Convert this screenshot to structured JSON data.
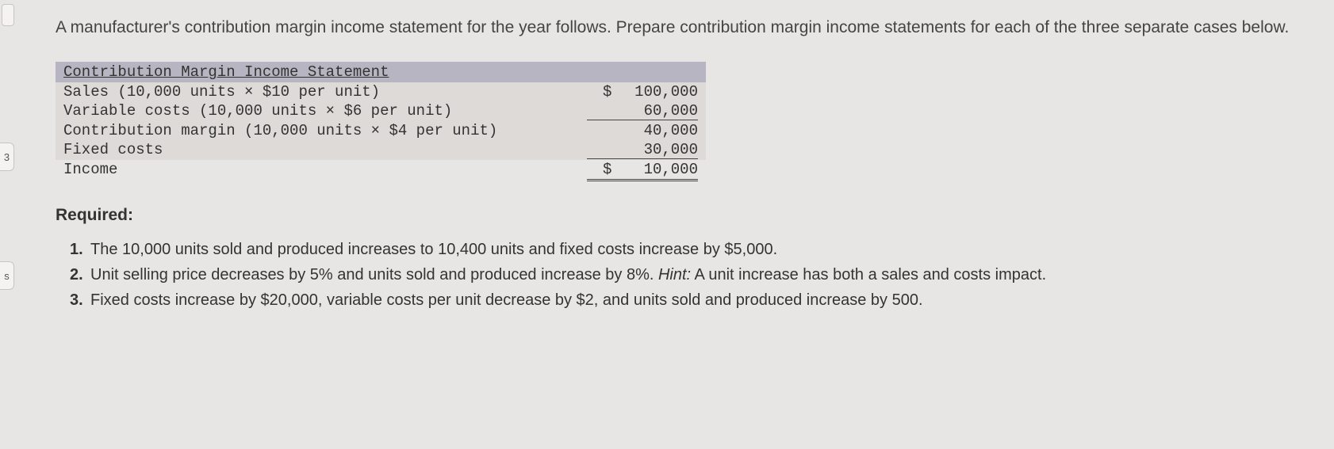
{
  "sidebar": {
    "tab1": "3",
    "tab2": "s"
  },
  "intro": "A manufacturer's contribution margin income statement for the year follows. Prepare contribution margin income statements for each of the three separate cases below.",
  "statement": {
    "header": "Contribution Margin Income Statement",
    "rows": [
      {
        "label": "Sales (10,000 units × $10 per unit)",
        "value": "100,000",
        "dollar": true
      },
      {
        "label": "Variable costs (10,000 units × $6 per unit)",
        "value": "60,000",
        "dollar": false
      },
      {
        "label": "Contribution margin (10,000 units × $4 per unit)",
        "value": "40,000",
        "dollar": false
      },
      {
        "label": "Fixed costs",
        "value": "30,000",
        "dollar": false
      },
      {
        "label": "Income",
        "value": "10,000",
        "dollar": true
      }
    ]
  },
  "required": {
    "header": "Required:",
    "items": [
      {
        "num": "1.",
        "text": "The 10,000 units sold and produced increases to 10,400 units and fixed costs increase by $5,000."
      },
      {
        "num": "2.",
        "text_before": "Unit selling price decreases by 5% and units sold and produced increase by 8%. ",
        "hint_label": "Hint:",
        "text_after": " A unit increase has both a sales and costs impact."
      },
      {
        "num": "3.",
        "text": "Fixed costs increase by $20,000, variable costs per unit decrease by $2, and units sold and produced increase by 500."
      }
    ]
  }
}
